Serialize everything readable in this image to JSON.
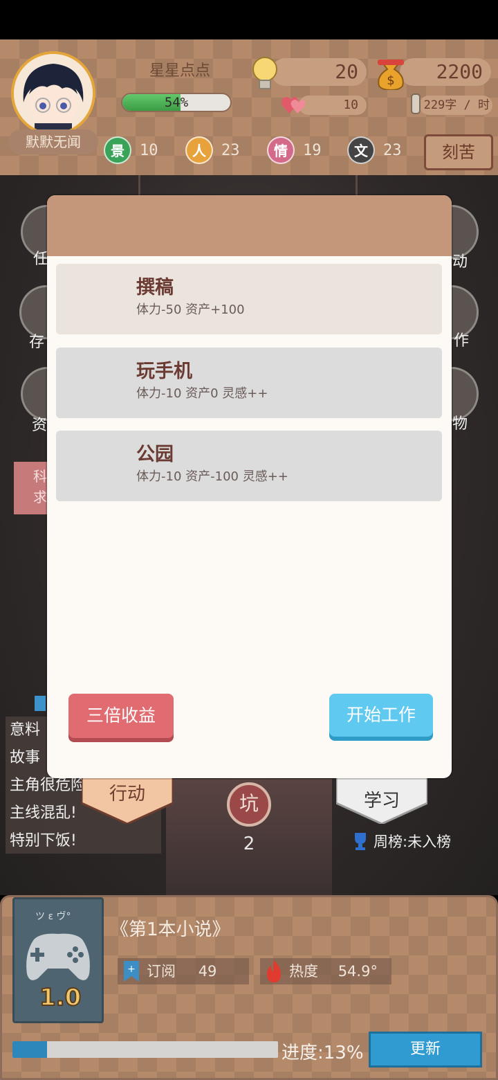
{
  "player": {
    "nickname": "星星点点",
    "title_tag": "默默无闻",
    "exp_percent": 54,
    "exp_label": "54%"
  },
  "resources": {
    "inspiration": "20",
    "money": "2200",
    "hearts": "10",
    "speed": "229字 / 时"
  },
  "attributes": [
    {
      "icon": "景",
      "value": "10",
      "color": "#3aa35a"
    },
    {
      "icon": "人",
      "value": "23",
      "color": "#e8a23c"
    },
    {
      "icon": "情",
      "value": "19",
      "color": "#d46a8a"
    },
    {
      "icon": "文",
      "value": "23",
      "color": "#444444"
    }
  ],
  "header": {
    "kuku_button": "刻苦"
  },
  "sidebar": {
    "left_labels": [
      "任",
      "存",
      "资"
    ],
    "right_labels": [
      "动",
      "作",
      "物"
    ],
    "tab_text": [
      "科",
      "求"
    ]
  },
  "modal": {
    "options": [
      {
        "title": "撰稿",
        "desc": "体力-50 资产+100"
      },
      {
        "title": "玩手机",
        "desc": "体力-10 资产0 灵感++"
      },
      {
        "title": "公园",
        "desc": "体力-10 资产-100 灵感++"
      }
    ],
    "triple_button": "三倍收益",
    "start_button": "开始工作"
  },
  "story_tags": [
    "意料",
    "故事",
    "主角很危险",
    "主线混乱!",
    "特别下饭!"
  ],
  "bottom_tabs": {
    "action": "行动",
    "study": "学习",
    "pit_label": "坑",
    "pit_count": "2",
    "weekly_rank": "周榜:未入榜"
  },
  "book": {
    "title": "《第1本小说》",
    "cover_version": "1.0",
    "cover_scribble": "ツ ε ヴ°",
    "subscribe_label": "订阅",
    "subscribe_value": "49",
    "heat_label": "热度",
    "heat_value": "54.9°",
    "progress_percent": 13,
    "progress_label": "进度:13%",
    "update_button": "更新"
  },
  "colors": {
    "panel_brown": "#b48a6a",
    "modal_header": "#c4977a",
    "start_blue": "#5fc9ef",
    "triple_red": "#e06b70"
  }
}
